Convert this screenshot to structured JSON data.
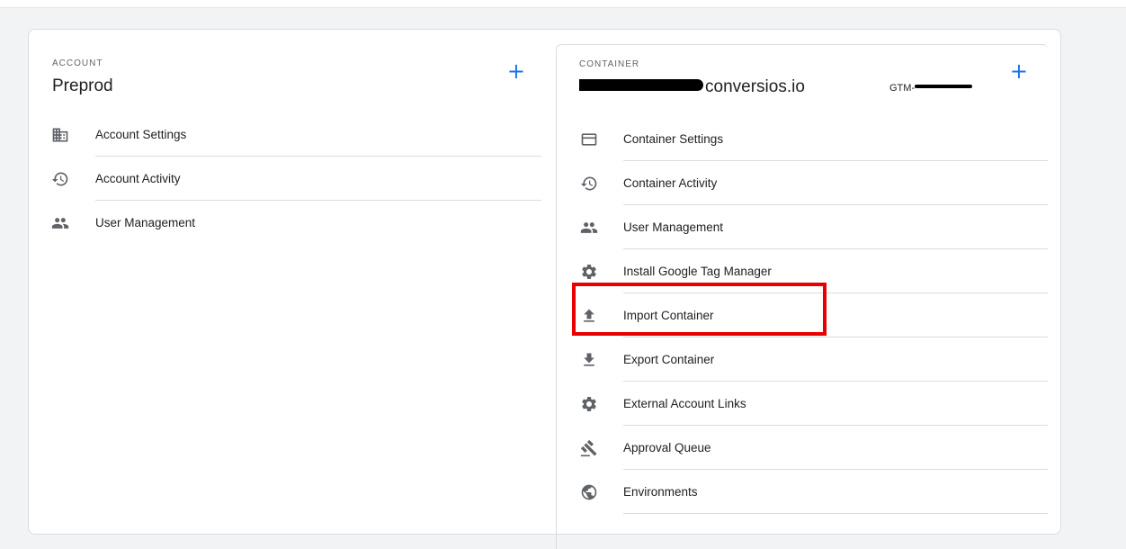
{
  "account": {
    "overline": "ACCOUNT",
    "name": "Preprod",
    "add_label": "+",
    "items": [
      {
        "label": "Account Settings",
        "icon": "building-icon"
      },
      {
        "label": "Account Activity",
        "icon": "history-icon"
      },
      {
        "label": "User Management",
        "icon": "people-icon"
      }
    ]
  },
  "container": {
    "overline": "CONTAINER",
    "name_suffix": "conversios.io",
    "id_prefix": "GTM-",
    "add_label": "+",
    "items": [
      {
        "label": "Container Settings",
        "icon": "window-icon"
      },
      {
        "label": "Container Activity",
        "icon": "history-icon"
      },
      {
        "label": "User Management",
        "icon": "people-icon"
      },
      {
        "label": "Install Google Tag Manager",
        "icon": "gear-icon"
      },
      {
        "label": "Import Container",
        "icon": "upload-icon"
      },
      {
        "label": "Export Container",
        "icon": "download-icon"
      },
      {
        "label": "External Account Links",
        "icon": "gear-icon"
      },
      {
        "label": "Approval Queue",
        "icon": "gavel-icon"
      },
      {
        "label": "Environments",
        "icon": "globe-icon"
      }
    ]
  },
  "colors": {
    "accent": "#1a73e8",
    "highlight": "#e60000",
    "icon": "#5f6368"
  }
}
